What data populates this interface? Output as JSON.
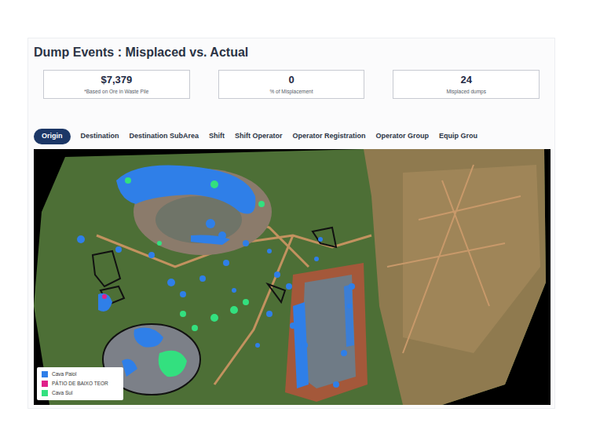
{
  "title": "Dump Events : Misplaced vs. Actual",
  "stats": [
    {
      "value": "$7,379",
      "label": "*Based on Ore in Waste Pile"
    },
    {
      "value": "0",
      "label": "% of Misplacement"
    },
    {
      "value": "24",
      "label": "Misplaced dumps"
    }
  ],
  "tabs": [
    {
      "label": "Origin",
      "selected": true
    },
    {
      "label": "Destination",
      "selected": false
    },
    {
      "label": "Destination SubArea",
      "selected": false
    },
    {
      "label": "Shift",
      "selected": false
    },
    {
      "label": "Shift Operator",
      "selected": false
    },
    {
      "label": "Operator Registration",
      "selected": false
    },
    {
      "label": "Operator Group",
      "selected": false
    },
    {
      "label": "Equip Grou",
      "selected": false
    }
  ],
  "map": {
    "legend": [
      {
        "label": "Cava Paiol",
        "color": "#2f7fe8"
      },
      {
        "label": "PÁTIO DE BAIXO TEOR",
        "color": "#e0218a"
      },
      {
        "label": "Cava Sul",
        "color": "#33e07f"
      }
    ]
  }
}
